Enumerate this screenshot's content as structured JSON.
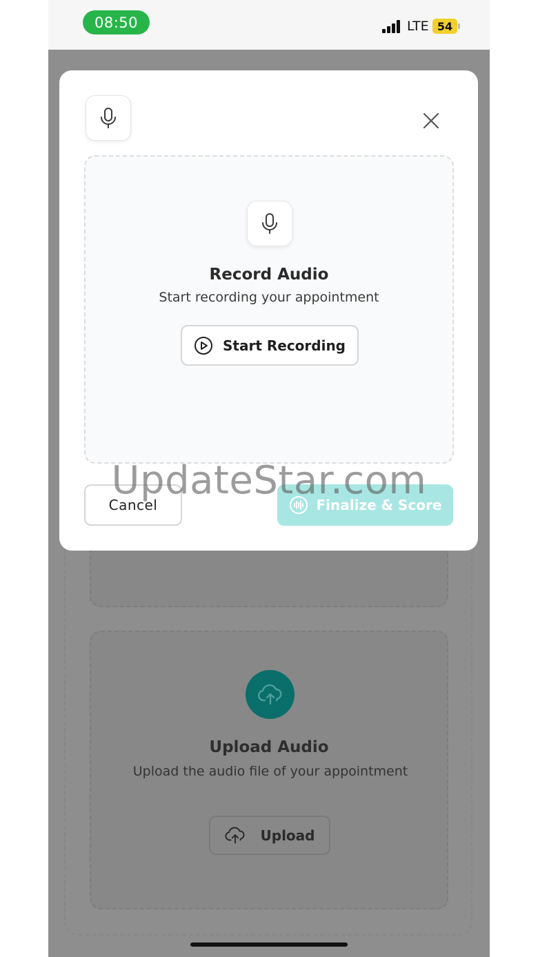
{
  "status_bar": {
    "time": "08:50",
    "network": "LTE",
    "battery": "54",
    "time_pill_color": "#27b54a",
    "battery_color": "#f2cf2c"
  },
  "modal": {
    "header_icon": "microphone-icon",
    "close_icon": "close-icon",
    "record": {
      "icon": "microphone-icon",
      "title": "Record Audio",
      "subtitle": "Start recording your appointment",
      "start_button_icon": "play-circle-icon",
      "start_button_label": "Start Recording"
    },
    "cancel_label": "Cancel",
    "finalize_icon": "soundwave-icon",
    "finalize_label": "Finalize & Score",
    "finalize_color": "#a8e6e3"
  },
  "background": {
    "upload": {
      "icon": "cloud-upload-icon",
      "title": "Upload Audio",
      "subtitle": "Upload the audio file of your appointment",
      "button_icon": "cloud-upload-icon",
      "button_label": "Upload",
      "accent_color": "#0a6e6a"
    }
  },
  "watermark": "UpdateStar.com"
}
